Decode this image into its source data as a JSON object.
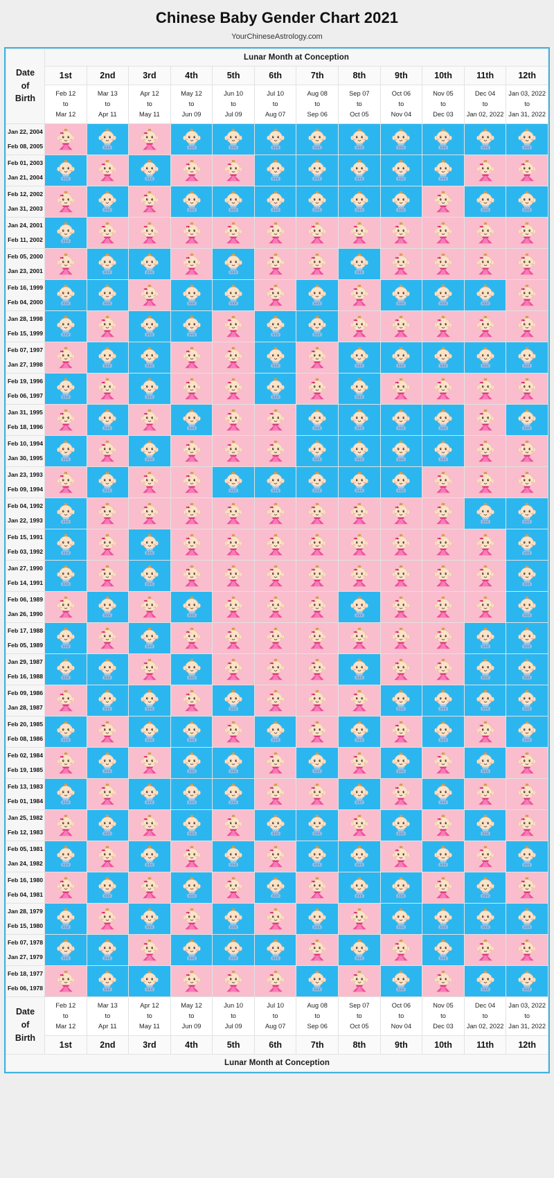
{
  "header": {
    "title": "Chinese Baby Gender Chart 2021",
    "subtitle": "YourChineseAstrology.com"
  },
  "labels": {
    "lunar_banner": "Lunar Month at Conception",
    "dob_line1": "Date",
    "dob_line2": "of",
    "dob_line3": "Birth",
    "to": "to",
    "girl_icon": "baby-girl-icon",
    "boy_icon": "baby-boy-icon"
  },
  "colors": {
    "girl": "#f9bdce",
    "boy": "#2cb6ef",
    "border": "#3bb3e0",
    "page_bg": "#eeeeee"
  },
  "chart_data": {
    "type": "table",
    "title": "Chinese Baby Gender Chart 2021",
    "xlabel": "Lunar Month at Conception",
    "ylabel": "Date of Birth",
    "legend": {
      "girl": "Girl (pink)",
      "boy": "Boy (blue)"
    },
    "months": [
      {
        "ordinal": "1st",
        "start": "Feb 12",
        "end": "Mar 12"
      },
      {
        "ordinal": "2nd",
        "start": "Mar 13",
        "end": "Apr 11"
      },
      {
        "ordinal": "3rd",
        "start": "Apr 12",
        "end": "May 11"
      },
      {
        "ordinal": "4th",
        "start": "May 12",
        "end": "Jun 09"
      },
      {
        "ordinal": "5th",
        "start": "Jun 10",
        "end": "Jul 09"
      },
      {
        "ordinal": "6th",
        "start": "Jul 10",
        "end": "Aug 07"
      },
      {
        "ordinal": "7th",
        "start": "Aug 08",
        "end": "Sep 06"
      },
      {
        "ordinal": "8th",
        "start": "Sep 07",
        "end": "Oct 05"
      },
      {
        "ordinal": "9th",
        "start": "Oct 06",
        "end": "Nov 04"
      },
      {
        "ordinal": "10th",
        "start": "Nov 05",
        "end": "Dec 03"
      },
      {
        "ordinal": "11th",
        "start": "Dec 04",
        "end": "Jan 02, 2022"
      },
      {
        "ordinal": "12th",
        "start": "Jan 03, 2022",
        "end": "Jan 31, 2022"
      }
    ],
    "rows": [
      {
        "start": "Jan 22, 2004",
        "end": "Feb 08, 2005",
        "genders": [
          "G",
          "B",
          "G",
          "B",
          "B",
          "B",
          "B",
          "B",
          "B",
          "B",
          "B",
          "B"
        ]
      },
      {
        "start": "Feb 01, 2003",
        "end": "Jan 21, 2004",
        "genders": [
          "B",
          "G",
          "B",
          "G",
          "G",
          "B",
          "B",
          "B",
          "B",
          "B",
          "G",
          "G"
        ]
      },
      {
        "start": "Feb 12, 2002",
        "end": "Jan 31, 2003",
        "genders": [
          "G",
          "B",
          "G",
          "B",
          "B",
          "B",
          "B",
          "B",
          "B",
          "G",
          "B",
          "B"
        ]
      },
      {
        "start": "Jan 24, 2001",
        "end": "Feb 11, 2002",
        "genders": [
          "B",
          "G",
          "G",
          "G",
          "G",
          "G",
          "G",
          "G",
          "G",
          "G",
          "G",
          "G"
        ]
      },
      {
        "start": "Feb 05, 2000",
        "end": "Jan 23, 2001",
        "genders": [
          "G",
          "B",
          "B",
          "G",
          "B",
          "G",
          "G",
          "B",
          "G",
          "G",
          "G",
          "G"
        ]
      },
      {
        "start": "Feb 16, 1999",
        "end": "Feb 04, 2000",
        "genders": [
          "B",
          "B",
          "G",
          "B",
          "B",
          "G",
          "B",
          "G",
          "B",
          "B",
          "B",
          "G"
        ]
      },
      {
        "start": "Jan 28, 1998",
        "end": "Feb 15, 1999",
        "genders": [
          "B",
          "G",
          "B",
          "B",
          "G",
          "B",
          "B",
          "G",
          "G",
          "G",
          "G",
          "G"
        ]
      },
      {
        "start": "Feb 07, 1997",
        "end": "Jan 27, 1998",
        "genders": [
          "G",
          "B",
          "B",
          "G",
          "G",
          "B",
          "G",
          "B",
          "B",
          "B",
          "B",
          "B"
        ]
      },
      {
        "start": "Feb 19, 1996",
        "end": "Feb 06, 1997",
        "genders": [
          "B",
          "G",
          "B",
          "G",
          "G",
          "B",
          "G",
          "B",
          "G",
          "G",
          "G",
          "G"
        ]
      },
      {
        "start": "Jan 31, 1995",
        "end": "Feb 18, 1996",
        "genders": [
          "G",
          "B",
          "G",
          "B",
          "G",
          "G",
          "B",
          "B",
          "B",
          "B",
          "G",
          "B"
        ]
      },
      {
        "start": "Feb 10, 1994",
        "end": "Jan 30, 1995",
        "genders": [
          "B",
          "G",
          "B",
          "G",
          "G",
          "G",
          "B",
          "B",
          "B",
          "B",
          "G",
          "G"
        ]
      },
      {
        "start": "Jan 23, 1993",
        "end": "Feb 09, 1994",
        "genders": [
          "G",
          "B",
          "G",
          "G",
          "B",
          "B",
          "B",
          "B",
          "B",
          "G",
          "G",
          "G"
        ]
      },
      {
        "start": "Feb 04, 1992",
        "end": "Jan 22, 1993",
        "genders": [
          "B",
          "G",
          "G",
          "G",
          "G",
          "G",
          "G",
          "G",
          "G",
          "G",
          "B",
          "B"
        ]
      },
      {
        "start": "Feb 15, 1991",
        "end": "Feb 03, 1992",
        "genders": [
          "B",
          "G",
          "B",
          "G",
          "G",
          "G",
          "G",
          "G",
          "G",
          "G",
          "G",
          "B"
        ]
      },
      {
        "start": "Jan 27, 1990",
        "end": "Feb 14, 1991",
        "genders": [
          "B",
          "G",
          "B",
          "G",
          "G",
          "G",
          "G",
          "G",
          "G",
          "G",
          "G",
          "B"
        ]
      },
      {
        "start": "Feb 06, 1989",
        "end": "Jan 26, 1990",
        "genders": [
          "G",
          "B",
          "G",
          "B",
          "G",
          "G",
          "G",
          "B",
          "G",
          "G",
          "G",
          "B"
        ]
      },
      {
        "start": "Feb 17, 1988",
        "end": "Feb 05, 1989",
        "genders": [
          "B",
          "G",
          "B",
          "G",
          "G",
          "G",
          "G",
          "G",
          "G",
          "G",
          "B",
          "B"
        ]
      },
      {
        "start": "Jan 29, 1987",
        "end": "Feb 16, 1988",
        "genders": [
          "B",
          "B",
          "G",
          "B",
          "G",
          "G",
          "G",
          "B",
          "G",
          "G",
          "B",
          "B"
        ]
      },
      {
        "start": "Feb 09, 1986",
        "end": "Jan 28, 1987",
        "genders": [
          "G",
          "B",
          "B",
          "G",
          "B",
          "G",
          "G",
          "G",
          "B",
          "B",
          "B",
          "B"
        ]
      },
      {
        "start": "Feb 20, 1985",
        "end": "Feb 08, 1986",
        "genders": [
          "B",
          "G",
          "B",
          "B",
          "G",
          "B",
          "G",
          "B",
          "G",
          "B",
          "G",
          "B"
        ]
      },
      {
        "start": "Feb 02, 1984",
        "end": "Feb 19, 1985",
        "genders": [
          "G",
          "B",
          "G",
          "B",
          "B",
          "G",
          "B",
          "G",
          "B",
          "G",
          "B",
          "G"
        ]
      },
      {
        "start": "Feb 13, 1983",
        "end": "Feb 01, 1984",
        "genders": [
          "B",
          "G",
          "B",
          "B",
          "B",
          "G",
          "G",
          "B",
          "G",
          "B",
          "G",
          "G"
        ]
      },
      {
        "start": "Jan 25, 1982",
        "end": "Feb 12, 1983",
        "genders": [
          "G",
          "B",
          "G",
          "B",
          "G",
          "B",
          "B",
          "G",
          "B",
          "G",
          "B",
          "G"
        ]
      },
      {
        "start": "Feb 05, 1981",
        "end": "Jan 24, 1982",
        "genders": [
          "B",
          "G",
          "B",
          "G",
          "B",
          "G",
          "B",
          "B",
          "G",
          "B",
          "G",
          "B"
        ]
      },
      {
        "start": "Feb 16, 1980",
        "end": "Feb 04, 1981",
        "genders": [
          "G",
          "B",
          "G",
          "B",
          "G",
          "B",
          "G",
          "B",
          "B",
          "G",
          "B",
          "G"
        ]
      },
      {
        "start": "Jan 28, 1979",
        "end": "Feb 15, 1980",
        "genders": [
          "B",
          "G",
          "B",
          "G",
          "B",
          "G",
          "B",
          "G",
          "B",
          "B",
          "B",
          "B"
        ]
      },
      {
        "start": "Feb 07, 1978",
        "end": "Jan 27, 1979",
        "genders": [
          "B",
          "B",
          "G",
          "B",
          "B",
          "B",
          "G",
          "B",
          "G",
          "B",
          "G",
          "G"
        ]
      },
      {
        "start": "Feb 18, 1977",
        "end": "Feb 06, 1978",
        "genders": [
          "G",
          "B",
          "B",
          "G",
          "G",
          "G",
          "B",
          "G",
          "B",
          "G",
          "B",
          "B"
        ]
      }
    ]
  }
}
